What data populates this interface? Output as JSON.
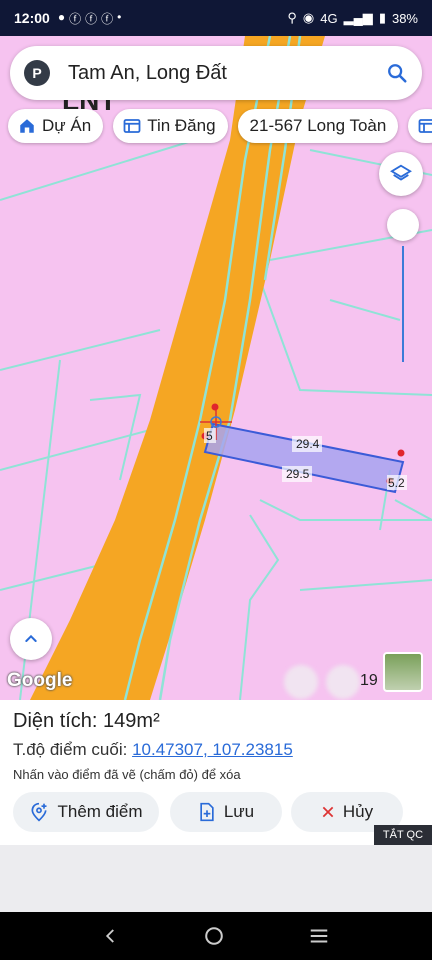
{
  "status": {
    "time": "12:00",
    "battery": "38%",
    "network": "4G"
  },
  "search": {
    "avatar_letter": "P",
    "query": "Tam An, Long Đất"
  },
  "chips": [
    {
      "label": "Dự Án",
      "icon": "home-icon"
    },
    {
      "label": "Tin Đăng",
      "icon": "listing-icon"
    },
    {
      "label": "21-567 Long Toàn",
      "icon": ""
    },
    {
      "label": "",
      "icon": "listing-icon"
    }
  ],
  "map": {
    "labels": {
      "top": "29.4",
      "bottom": "29.5",
      "left": "5",
      "right": "5.2"
    },
    "google": "Google",
    "scale_text": "19"
  },
  "panel": {
    "area_label": "Diện tích: 149m²",
    "coord_label": "T.độ điểm cuối: ",
    "coord_value": "10.47307, 107.23815",
    "hint": "Nhấn vào điểm đã vẽ (chấm đỏ) để xóa",
    "buttons": {
      "add": "Thêm điểm",
      "save": "Lưu",
      "cancel": "Hủy"
    },
    "ad_close": "TẮT QC"
  },
  "colors": {
    "parcel": "#f6c3f0",
    "road": "#f5a623",
    "boundary": "#8fe3d6",
    "polygon": "#a7a3f0",
    "link": "#2a6bd8"
  }
}
